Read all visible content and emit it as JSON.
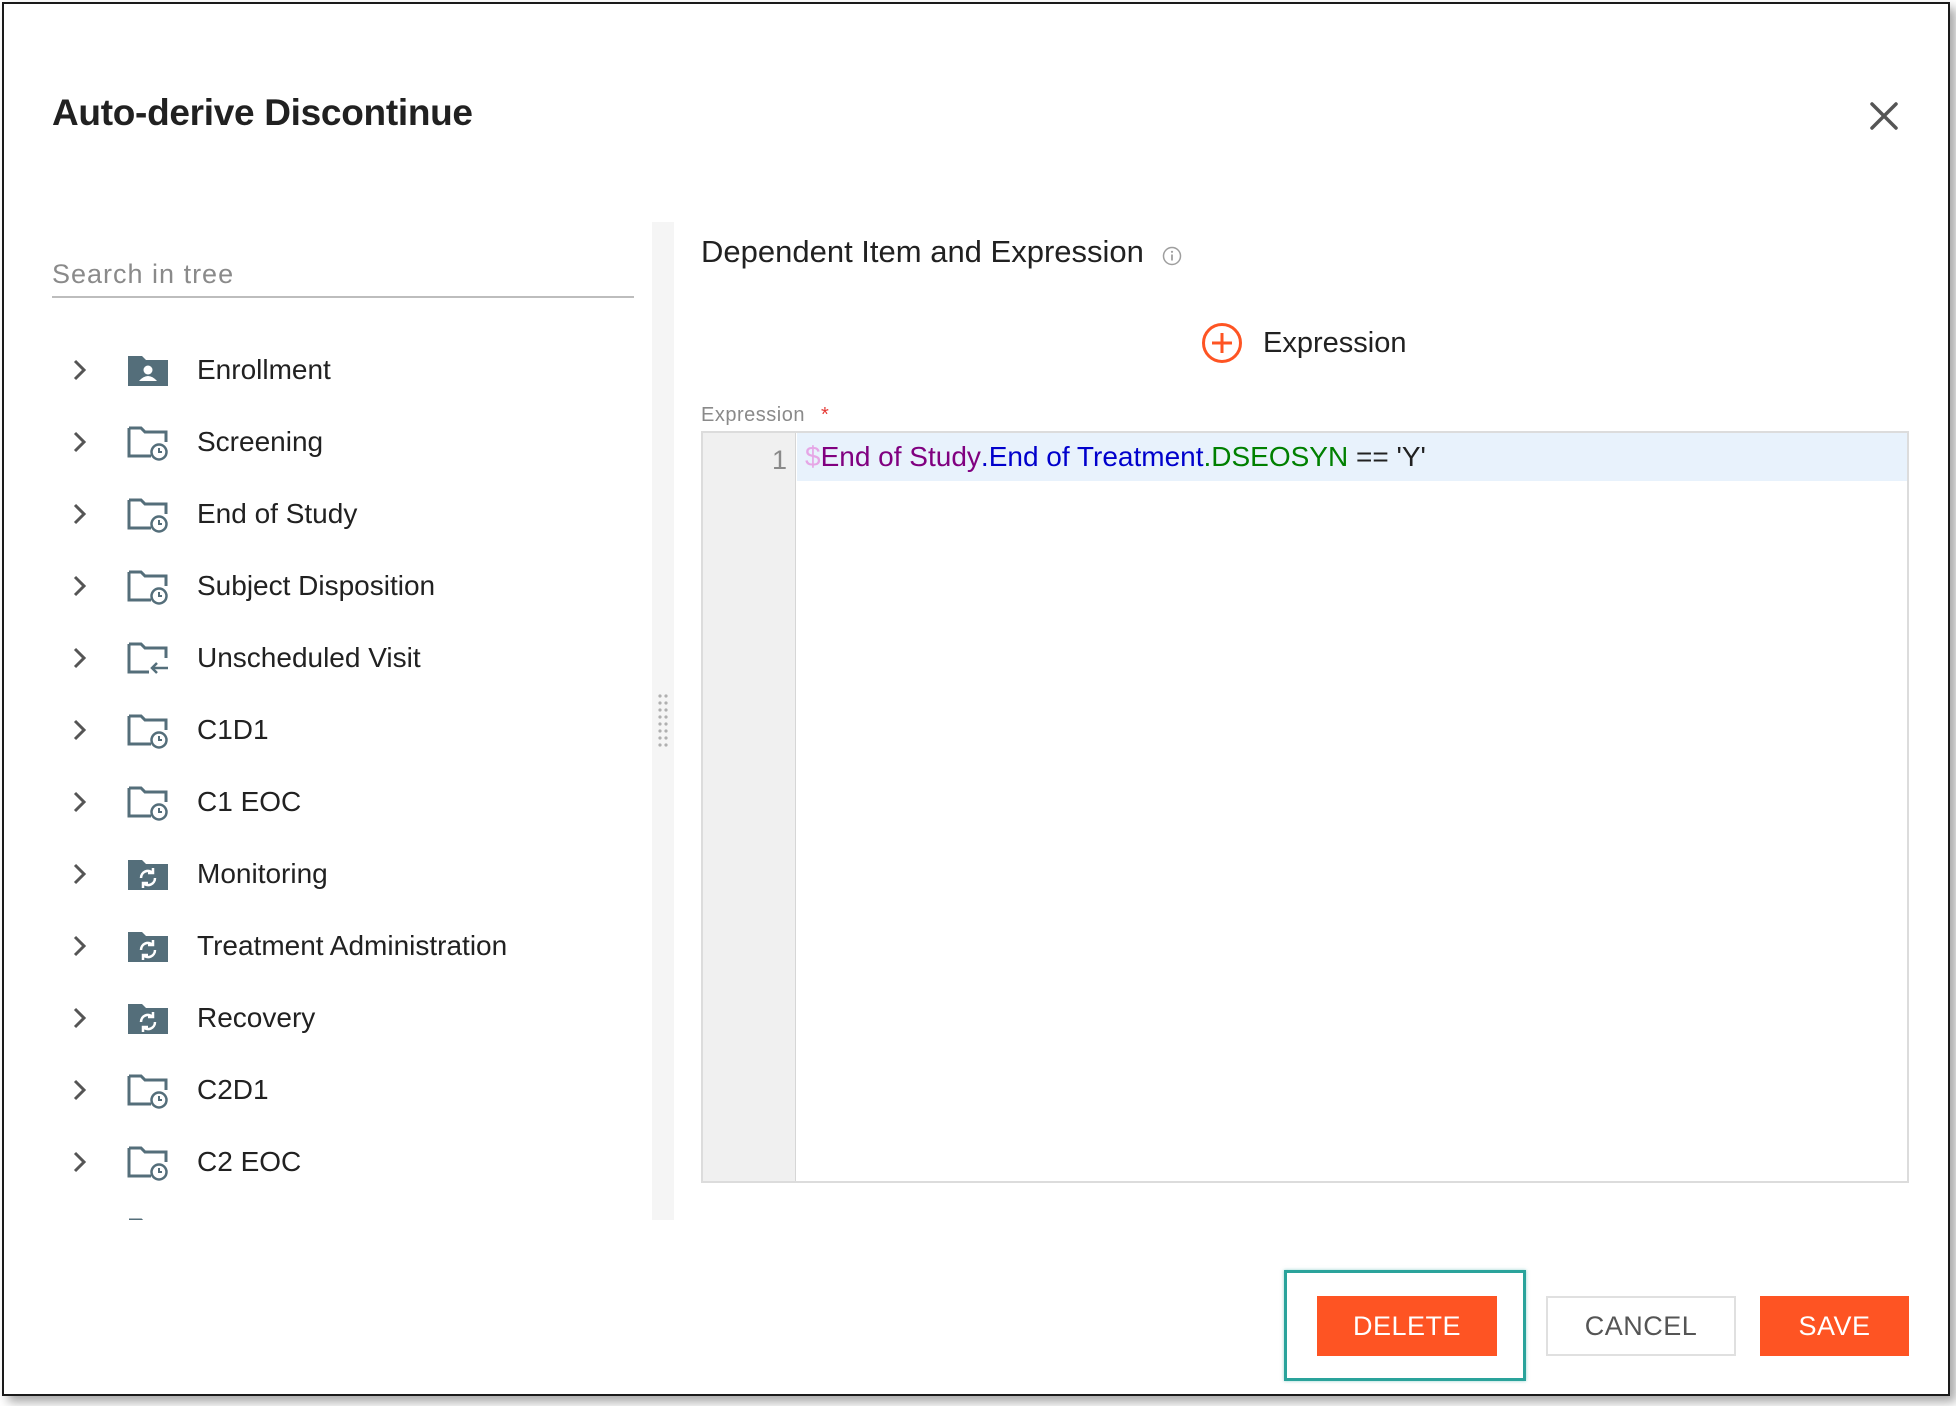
{
  "dialog": {
    "title": "Auto-derive Discontinue",
    "close_icon": "close-icon"
  },
  "tree": {
    "search_placeholder": "Search in tree",
    "items": [
      {
        "label": "Enrollment",
        "icon": "subject-folder-icon"
      },
      {
        "label": "Screening",
        "icon": "scheduled-folder-icon"
      },
      {
        "label": "End of Study",
        "icon": "scheduled-folder-icon"
      },
      {
        "label": "Subject Disposition",
        "icon": "scheduled-folder-icon"
      },
      {
        "label": "Unscheduled Visit",
        "icon": "unscheduled-folder-icon"
      },
      {
        "label": "C1D1",
        "icon": "scheduled-folder-icon"
      },
      {
        "label": "C1 EOC",
        "icon": "scheduled-folder-icon"
      },
      {
        "label": "Monitoring",
        "icon": "cycle-folder-icon"
      },
      {
        "label": "Treatment Administration",
        "icon": "cycle-folder-icon"
      },
      {
        "label": "Recovery",
        "icon": "cycle-folder-icon"
      },
      {
        "label": "C2D1",
        "icon": "scheduled-folder-icon"
      },
      {
        "label": "C2 EOC",
        "icon": "scheduled-folder-icon"
      }
    ]
  },
  "right_panel": {
    "section_title": "Dependent Item and Expression",
    "add_expression_label": "Expression",
    "expression_field_label": "Expression",
    "required_marker": "*",
    "editor": {
      "line_number": "1",
      "code": {
        "dollar": "$",
        "form": "End of Study",
        "dot1": ".",
        "event": "End of Treatment",
        "dot2": ".",
        "item": "DSEOSYN",
        "operator": " == 'Y'"
      }
    }
  },
  "footer": {
    "delete_label": "DELETE",
    "cancel_label": "CANCEL",
    "save_label": "SAVE"
  },
  "colors": {
    "accent": "#fe5423",
    "highlight": "#2aa39b",
    "folder": "#546e7a"
  }
}
